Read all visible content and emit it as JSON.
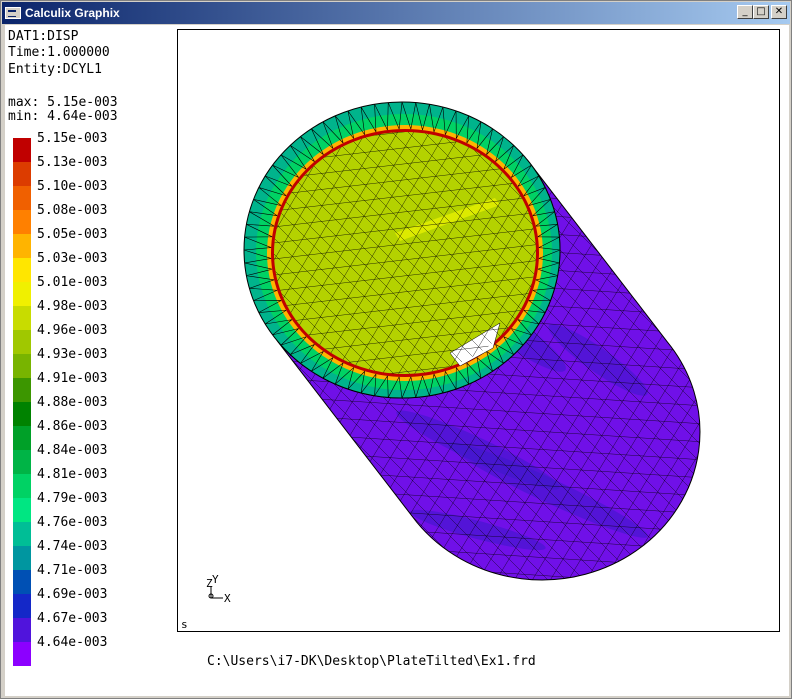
{
  "window": {
    "title": "Calculix Graphix",
    "minimize_glyph": "_",
    "maximize_glyph": "□",
    "close_glyph": "✕"
  },
  "info": {
    "dataset": "DAT1:DISP",
    "time": "Time:1.000000",
    "entity": "Entity:DCYL1",
    "max": "max: 5.15e-003",
    "min": "min: 4.64e-003"
  },
  "legend": {
    "entries": [
      {
        "label": "5.15e-003",
        "color": "#c00000"
      },
      {
        "label": "5.13e-003",
        "color": "#dc3c00"
      },
      {
        "label": "5.10e-003",
        "color": "#f06000"
      },
      {
        "label": "5.08e-003",
        "color": "#ff8000"
      },
      {
        "label": "5.05e-003",
        "color": "#ffb400"
      },
      {
        "label": "5.03e-003",
        "color": "#ffe600"
      },
      {
        "label": "5.01e-003",
        "color": "#f0f000"
      },
      {
        "label": "4.98e-003",
        "color": "#c8dc00"
      },
      {
        "label": "4.96e-003",
        "color": "#a0c800"
      },
      {
        "label": "4.93e-003",
        "color": "#78b400"
      },
      {
        "label": "4.91e-003",
        "color": "#3c9600"
      },
      {
        "label": "4.88e-003",
        "color": "#008200"
      },
      {
        "label": "4.86e-003",
        "color": "#00a028"
      },
      {
        "label": "4.84e-003",
        "color": "#00b446"
      },
      {
        "label": "4.81e-003",
        "color": "#00d264"
      },
      {
        "label": "4.79e-003",
        "color": "#00e682"
      },
      {
        "label": "4.76e-003",
        "color": "#00be96"
      },
      {
        "label": "4.74e-003",
        "color": "#0096a0"
      },
      {
        "label": "4.71e-003",
        "color": "#0050b4"
      },
      {
        "label": "4.69e-003",
        "color": "#1428c8"
      },
      {
        "label": "4.67e-003",
        "color": "#5014dc"
      },
      {
        "label": "4.64e-003",
        "color": "#8c00ff"
      }
    ]
  },
  "viewport": {
    "axis_z": "Z",
    "axis_y": "Y",
    "axis_x": "X",
    "corner_mark": "s",
    "colors": {
      "outer_surface": "#7010e8",
      "inner_surface": "#b4d200",
      "rim_outer": "#00b48c",
      "rim_mid": "#00d264",
      "rim_inner": "#ffb400",
      "rim_edge": "#c00000",
      "dark_band": "#3c18c8",
      "mesh_line": "#000000"
    }
  },
  "status": {
    "file_path": "C:\\Users\\i7-DK\\Desktop\\PlateTilted\\Ex1.frd"
  }
}
